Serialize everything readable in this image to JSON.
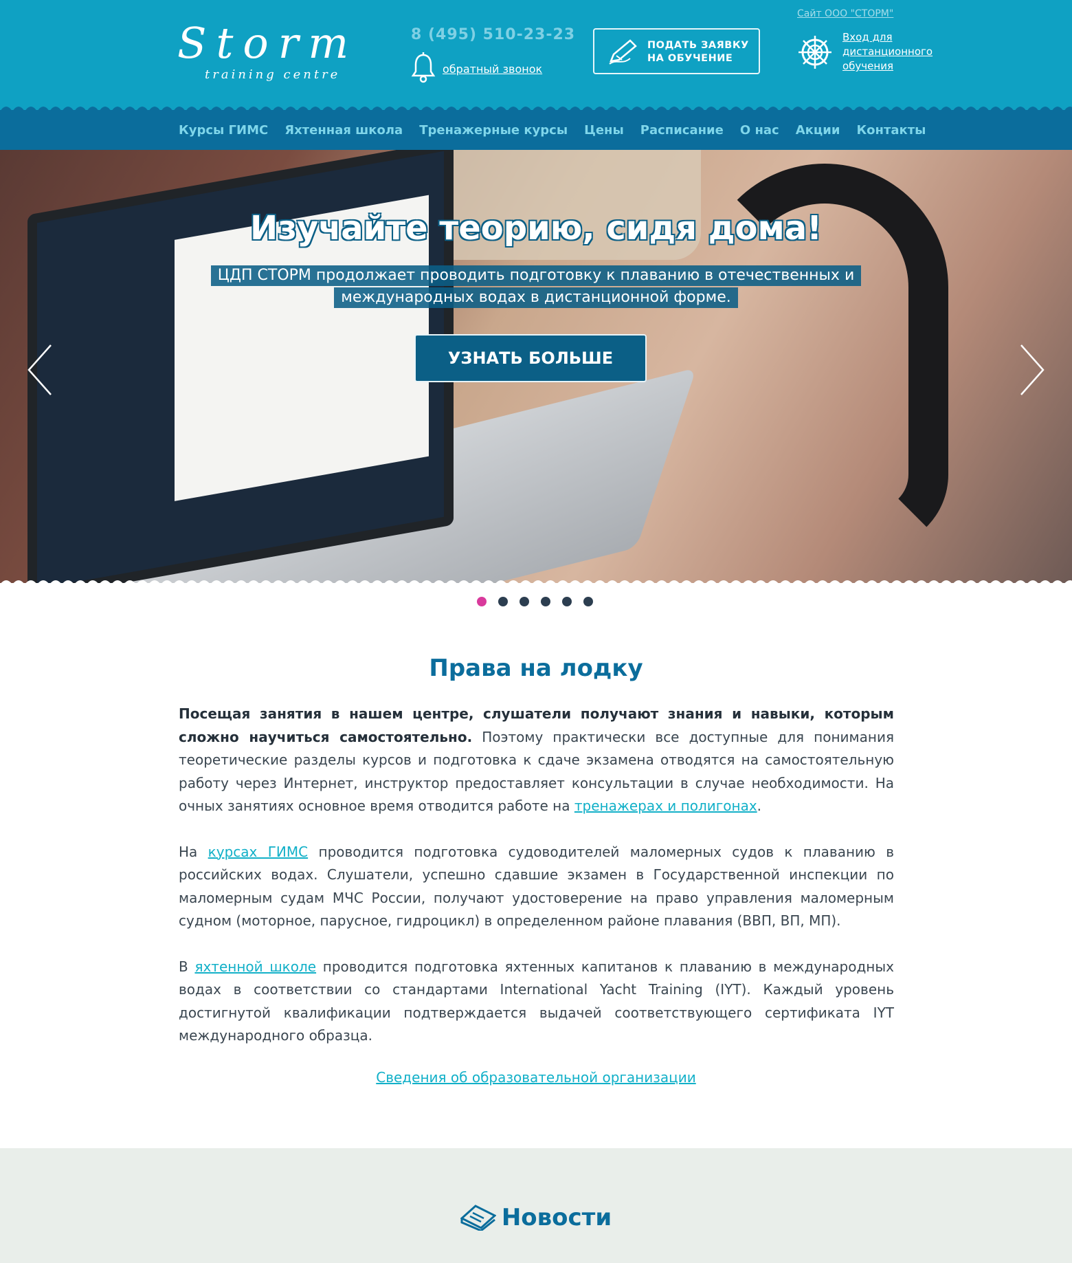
{
  "header": {
    "site_link": "Сайт ООО \"СТОРМ\"",
    "logo_word": "Storm",
    "logo_sub": "training centre",
    "phone": "8 (495) 510-23-23",
    "callback": "обратный звонок",
    "apply_line1": "ПОДАТЬ ЗАЯВКУ",
    "apply_line2": "НА ОБУЧЕНИЕ",
    "distance_line1": "Вход для",
    "distance_line2": "дистанционного",
    "distance_line3": "обучения"
  },
  "nav": {
    "items": [
      "Курсы ГИМС",
      "Яхтенная школа",
      "Тренажерные курсы",
      "Цены",
      "Расписание",
      "О нас",
      "Акции",
      "Контакты"
    ]
  },
  "hero": {
    "title": "Изучайте теорию, сидя дома!",
    "sub_line1": "ЦДП СТОРМ продолжает проводить подготовку к плаванию в отечественных и",
    "sub_line2": "международных водах в дистанционной форме.",
    "button": "УЗНАТЬ БОЛЬШЕ",
    "slides_total": 6,
    "active_slide": 1
  },
  "main": {
    "title": "Права на лодку",
    "p1_bold": "Посещая занятия в нашем центре, слушатели получают знания и навыки, которым сложно научиться самостоятельно.",
    "p1_text": " Поэтому практически все доступные для понимания теоретические разделы курсов и подготовка к сдаче экзамена отводятся на самостоятельную работу через Интернет, инструктор предоставляет консультации в случае необходимости. На очных занятиях основное время отводится работе на ",
    "p1_link": "тренажерах и полигонах",
    "p1_end": ".",
    "p2_start": "На ",
    "p2_link": "курсах ГИМС",
    "p2_text": " проводится подготовка судоводителей маломерных судов к плаванию в российских водах. Слушатели, успешно сдавшие экзамен в Государственной инспекции по маломерным судам МЧС России, получают удостоверение на право управления маломерным судном (моторное, парусное, гидроцикл) в определенном районе плавания (ВВП, ВП, МП).",
    "p3_start": "В ",
    "p3_link": "яхтенной школе",
    "p3_text": " проводится подготовка яхтенных капитанов к плаванию в международных водах в соответствии со стандартами International Yacht Training (IYT). Каждый уровень достигнутой квалификации подтверждается выдачей соответствующего сертификата IYT международного образца.",
    "org_link": "Сведения об образовательной организации"
  },
  "news": {
    "title": "Новости"
  },
  "colors": {
    "header_bg": "#0fa1c3",
    "nav_bg": "#0b6d9c",
    "accent": "#12b0c8",
    "dot_active": "#d93a9c"
  }
}
